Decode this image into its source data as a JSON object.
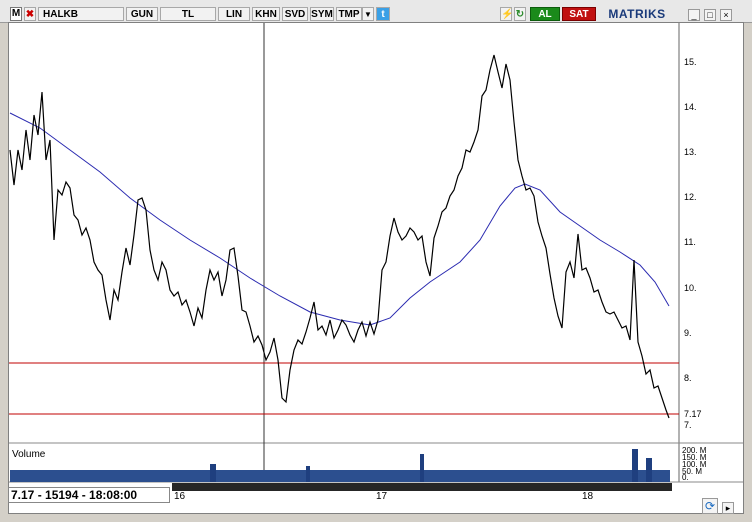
{
  "toolbar": {
    "menu_icon": "M",
    "symbol": "HALKB",
    "buttons": [
      "GUN",
      "TL",
      "LIN",
      "KHN",
      "SVD",
      "SYM",
      "TMP"
    ],
    "buy_label": "AL",
    "sell_label": "SAT",
    "brand": "MATRIKS",
    "window_controls": [
      "_",
      "□",
      "×"
    ]
  },
  "chart": {
    "y_ticks": [
      "15.",
      "14.",
      "13.",
      "12.",
      "11.",
      "10.",
      "9.",
      "8.",
      "7.17",
      "7."
    ],
    "x_ticks": [
      "16",
      "17",
      "18"
    ],
    "volume_label": "Volume",
    "volume_ticks": [
      "200. M",
      "150. M",
      "100. M",
      "50. M",
      "0."
    ],
    "info": "7.17 - 15194 - 18:08:00"
  },
  "chart_data": {
    "type": "line",
    "series": [],
    "y_range": [
      6.8,
      15.8
    ],
    "horizontal_lines": [
      8.37,
      7.17
    ],
    "last_value": 7.17,
    "x_labels": [
      "16",
      "17",
      "18"
    ]
  }
}
